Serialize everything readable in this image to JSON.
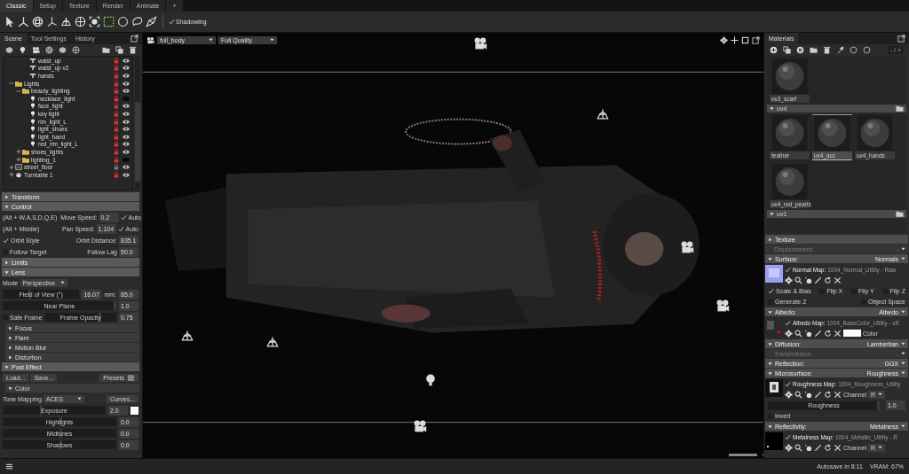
{
  "menu_tabs": [
    {
      "label": "Classic",
      "selected": true
    },
    {
      "label": "Setup",
      "selected": false
    },
    {
      "label": "Texture",
      "selected": false
    },
    {
      "label": "Render",
      "selected": false
    },
    {
      "label": "Animate",
      "selected": false
    },
    {
      "label": "+",
      "selected": false
    }
  ],
  "toolbar": {
    "shadowing": {
      "label": "Shadowing",
      "checked": true
    }
  },
  "scene_panel": {
    "tabs": [
      {
        "label": "Scene",
        "selected": true
      },
      {
        "label": "Tool Settings",
        "selected": false
      },
      {
        "label": "History",
        "selected": false
      }
    ],
    "tree_continued": [
      {
        "label": "waist_up",
        "kind": "mesh",
        "locked": true,
        "visible": true
      },
      {
        "label": "waist_up v2",
        "kind": "mesh",
        "locked": true,
        "visible": true
      },
      {
        "label": "hands",
        "kind": "mesh",
        "locked": true,
        "visible": true
      }
    ],
    "tree": [
      {
        "label": "Lights",
        "kind": "folder",
        "expanded": true,
        "locked": true,
        "visible": true,
        "children": [
          {
            "label": "beauty_lighting",
            "kind": "folder",
            "expanded": true,
            "locked": true,
            "visible": true,
            "children": [
              {
                "label": "necklace_light",
                "kind": "light",
                "locked": true,
                "visible": false
              },
              {
                "label": "face_light",
                "kind": "light",
                "locked": true,
                "visible": true
              },
              {
                "label": "key light",
                "kind": "light",
                "locked": true,
                "visible": true
              },
              {
                "label": "rim_light_L",
                "kind": "light",
                "locked": true,
                "visible": true
              },
              {
                "label": "light_shoes",
                "kind": "light",
                "locked": true,
                "visible": true
              },
              {
                "label": "light_hand",
                "kind": "light",
                "locked": true,
                "visible": true
              },
              {
                "label": "red_rim_light_L",
                "kind": "light",
                "locked": true,
                "visible": true
              }
            ]
          },
          {
            "label": "shoes_lights",
            "kind": "folder",
            "expanded": false,
            "locked": true,
            "visible": true
          },
          {
            "label": "lighting_1",
            "kind": "folder",
            "expanded": false,
            "locked": true,
            "visible": false
          }
        ]
      },
      {
        "label": "street_floor",
        "kind": "floor",
        "expanded": false,
        "locked": false,
        "visible": true
      },
      {
        "label": "Turntable 1",
        "kind": "turntable",
        "expanded": false,
        "locked": true,
        "visible": true
      }
    ],
    "settings": [
      {
        "kind": "section",
        "label": "Transform",
        "expanded": false
      },
      {
        "kind": "section",
        "label": "Control",
        "expanded": true
      },
      {
        "kind": "control",
        "hint": "(Alt + W,A,S,D,Q,E)",
        "label": "Move Speed:",
        "value": "0.2",
        "auto": {
          "label": "Auto",
          "checked": true
        }
      },
      {
        "kind": "control",
        "hint": "(Alt + Middle)",
        "label": "Pan Speed:",
        "value": "1.104",
        "auto": {
          "label": "Auto",
          "checked": true
        }
      },
      {
        "kind": "control",
        "check": {
          "label": "Orbit Style",
          "checked": true
        },
        "label": "Orbit Distance:",
        "value": "835.1"
      },
      {
        "kind": "control",
        "check": {
          "label": "Follow Target",
          "checked": false
        },
        "label": "Follow Lag",
        "value": "50.0"
      },
      {
        "kind": "section",
        "label": "Limits",
        "expanded": false
      },
      {
        "kind": "section",
        "label": "Lens",
        "expanded": true
      },
      {
        "kind": "select",
        "label": "Mode",
        "value": "Perspective"
      },
      {
        "kind": "slider",
        "label": "Field of View (°)",
        "level": 0.33,
        "value": "16.07",
        "extra": {
          "label": "mm:",
          "value": "85.0"
        }
      },
      {
        "kind": "slider",
        "label": "Near Plane",
        "level": 0.98,
        "value": "1.0"
      },
      {
        "kind": "slider",
        "check": {
          "label": "Safe Frame",
          "checked": false
        },
        "label": "Frame Opacity",
        "level": 0.75,
        "value": "0.75"
      },
      {
        "kind": "subsection",
        "label": "Focus",
        "expanded": false
      },
      {
        "kind": "subsection",
        "label": "Flare",
        "expanded": false
      },
      {
        "kind": "subsection",
        "label": "Motion Blur",
        "expanded": false
      },
      {
        "kind": "subsection",
        "label": "Distortion",
        "expanded": false
      },
      {
        "kind": "section",
        "label": "Post Effect",
        "expanded": true
      },
      {
        "kind": "buttons",
        "buttons": [
          "Load...",
          "Save..."
        ],
        "menu": "Presets"
      },
      {
        "kind": "subsection",
        "label": "Color",
        "expanded": true
      },
      {
        "kind": "select",
        "label": "Tone Mapping",
        "value": "ACES",
        "button": "Curves..."
      },
      {
        "kind": "slider",
        "label": "Exposure",
        "level": 0.36,
        "value": "2.0",
        "color": "#ffffff"
      },
      {
        "kind": "slider",
        "label": "Highlights",
        "level": 0.5,
        "value": "0.0"
      },
      {
        "kind": "slider",
        "label": "Midtones",
        "level": 0.5,
        "value": "0.0"
      },
      {
        "kind": "slider",
        "label": "Shadows",
        "level": 0.5,
        "value": "0.0"
      }
    ]
  },
  "viewport": {
    "object_select": "full_body",
    "quality_select": "Full Quality",
    "render_progress": {
      "level": 1
    }
  },
  "materials_panel": {
    "tab": "Materials",
    "page_field": "- / +",
    "materials_continued": [
      {
        "label": "uv3_scarf",
        "selected": false
      }
    ],
    "groups": [
      {
        "label": "uv4",
        "materials": [
          {
            "label": "feather",
            "selected": false
          },
          {
            "label": "uv4_acc",
            "selected": true
          },
          {
            "label": "uv4_hands",
            "selected": false
          },
          {
            "label": "uv4_red_pearls",
            "selected": false
          }
        ]
      },
      {
        "label": "uv1"
      }
    ],
    "properties": [
      {
        "kind": "header",
        "label": "Texture",
        "expanded": false
      },
      {
        "kind": "header",
        "label": "Displacement:",
        "value": "-",
        "disabled": true
      },
      {
        "kind": "header",
        "label": "Surface:",
        "value": "Normals",
        "expanded": true,
        "disabled": false
      },
      {
        "kind": "map",
        "label": "Normal Map:",
        "file": "1004_Normal_Utility - Raw",
        "checked": true
      },
      {
        "kind": "checks",
        "items": [
          {
            "label": "Scale & Bias",
            "checked": true
          },
          {
            "label": "Flip X",
            "checked": false
          },
          {
            "label": "Flip Y",
            "checked": false
          },
          {
            "label": "Flip Z",
            "checked": false
          }
        ]
      },
      {
        "kind": "checks",
        "items": [
          {
            "label": "Generate Z",
            "checked": false
          },
          {
            "label": "Object Space",
            "checked": false
          }
        ]
      },
      {
        "kind": "header",
        "label": "Albedo:",
        "value": "Albedo",
        "expanded": true,
        "disabled": false
      },
      {
        "kind": "map",
        "label": "Albedo Map:",
        "file": "1004_BaseColor_Utility - sR",
        "checked": true,
        "color_field": {
          "color": "#ffffff",
          "label": "Color"
        }
      },
      {
        "kind": "header",
        "label": "Diffusion:",
        "value": "Lambertian",
        "expanded": true,
        "disabled": false
      },
      {
        "kind": "header",
        "label": "Transmission:",
        "value": "-",
        "disabled": true
      },
      {
        "kind": "header",
        "label": "Reflection:",
        "value": "GGX",
        "expanded": true,
        "disabled": false
      },
      {
        "kind": "header",
        "label": "Microsurface:",
        "value": "Roughness",
        "expanded": true,
        "disabled": false
      },
      {
        "kind": "map",
        "label": "Roughness Map:",
        "file": "1004_Roughness_Utility",
        "checked": true,
        "channel": {
          "label": "Channel",
          "value": "R"
        }
      },
      {
        "kind": "slider",
        "label": "Roughness",
        "level": 0.98,
        "value": "1.0"
      },
      {
        "kind": "check",
        "label": "Invert",
        "checked": false
      },
      {
        "kind": "header",
        "label": "Reflectivity:",
        "value": "Metalness",
        "expanded": true,
        "disabled": false
      },
      {
        "kind": "map",
        "label": "Metalness Map:",
        "file": "1004_Metallic_Utility - R",
        "checked": true,
        "channel": {
          "label": "Channel",
          "value": "R"
        }
      }
    ]
  },
  "status_bar": {
    "autosave": "Autosave in 8:11",
    "vram": "VRAM: 67%"
  }
}
